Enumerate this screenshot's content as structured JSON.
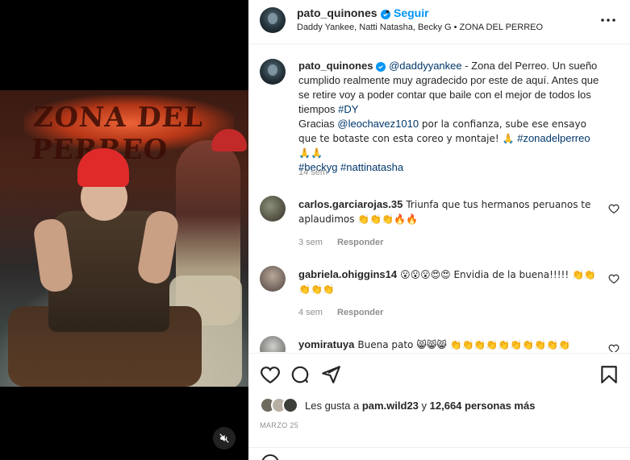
{
  "header": {
    "username": "pato_quinones",
    "separator": "•",
    "follow_label": "Seguir",
    "subtitle": "Daddy Yankee, Natti Natasha, Becky G • ZONA DEL PERREO",
    "more_icon": "more-horizontal-icon"
  },
  "video": {
    "sign_text": "ZONA DEL PERREO",
    "mute_icon": "muted-speaker-icon"
  },
  "caption": {
    "username": "pato_quinones",
    "mention": "@daddyyankee",
    "text1": " - Zona del Perreo. Un sueño cumplido realmente muy agradecido por este de aquí. Antes que se retire voy a poder contar que baile con el mejor de todos los tiempos ",
    "tag_dy": "#DY",
    "text2": "Gracias ",
    "mention2": "@leochavez1010",
    "text3": " por la confianza, sube ese ensayo que te botaste con esta coreo y montaje! 🙏 ",
    "tag_zona": "#zonadelperreo",
    "text4": " 🙏🙏",
    "tag_becky": "#beckyg",
    "tag_natti": "#nattinatasha",
    "time": "14 sem"
  },
  "comments": [
    {
      "username": "carlos.garciarojas.35",
      "text": "Triunfa que tus hermanos peruanos te aplaudimos 👏👏👏🔥🔥",
      "time": "3 sem",
      "reply": "Responder"
    },
    {
      "username": "gabriela.ohiggins14",
      "text": "😮😮😮😍😍 Envidia de la buena!!!!! 👏👏👏👏👏",
      "time": "4 sem",
      "reply": "Responder"
    },
    {
      "username": "yomiratuya",
      "text": "Buena pato 😸😸😸 👏👏👏👏👏👏👏👏👏👏",
      "time": "",
      "reply": ""
    }
  ],
  "actions": {
    "like_icon": "heart-icon",
    "comment_icon": "comment-icon",
    "share_icon": "send-icon",
    "save_icon": "bookmark-icon"
  },
  "likes": {
    "prefix": "Les gusta a ",
    "user": "pam.wild23",
    "middle": " y ",
    "count": "12,664 personas más"
  },
  "date": "MARZO 25",
  "colors": {
    "accent": "#0095f6",
    "link": "#00376b",
    "muted": "#8e8e8e"
  }
}
